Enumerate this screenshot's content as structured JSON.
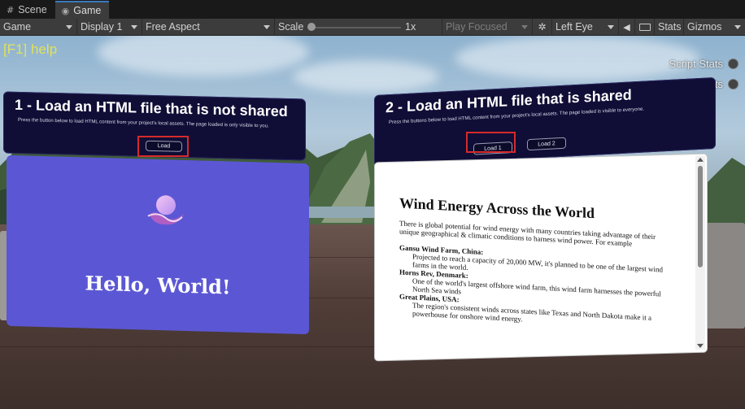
{
  "tabs": [
    {
      "label": "Scene",
      "icon": "grid-icon",
      "active": false
    },
    {
      "label": "Game",
      "icon": "gamepad-icon",
      "active": true
    }
  ],
  "toolbar": {
    "game_dropdown": "Game",
    "display_dropdown": "Display 1",
    "aspect_dropdown": "Free Aspect",
    "scale_label": "Scale",
    "scale_value": "1x",
    "play_mode_dropdown": "Play Focused",
    "eye_dropdown": "Left Eye",
    "stats_button": "Stats",
    "gizmos_dropdown": "Gizmos"
  },
  "overlay": {
    "help_text": "[F1] help",
    "script_stats": "Script Stats",
    "perf_stats": "Perf Stats"
  },
  "panel_left": {
    "title": "1 - Load an HTML file that is not shared",
    "description": "Press the button below to load HTML content from your project's local assets. The page loaded is only visible to you.",
    "load_button": "Load",
    "content_text": "Hello, World!"
  },
  "panel_right": {
    "title": "2 - Load an HTML file that is shared",
    "description": "Press the buttons below to load HTML content from your project's local assets. The page loaded is visible to everyone.",
    "load1_button": "Load 1",
    "load2_button": "Load 2",
    "doc": {
      "heading": "Wind Energy Across the World",
      "intro": "There is global potential for wind energy with many countries taking advantage of their unique geographical & climatic conditions to harness wind power. For example",
      "items": [
        {
          "name": "Gansu Wind Farm, China:",
          "text": "Projected to reach a capacity of 20,000 MW, it's planned to be one of the largest wind farms in the world."
        },
        {
          "name": "Horns Rev, Denmark:",
          "text": "One of the world's largest offshore wind farm, this wind farm harnesses the powerful North Sea winds"
        },
        {
          "name": "Great Plains, USA:",
          "text": "The region's consistent winds across states like Texas and North Dakota make it a powerhouse for onshore wind energy."
        }
      ]
    }
  },
  "colors": {
    "highlight": "#d62a2a",
    "header_bg": "#100e36",
    "purple_panel": "#5b57d4",
    "help_text": "#e1e25a"
  }
}
